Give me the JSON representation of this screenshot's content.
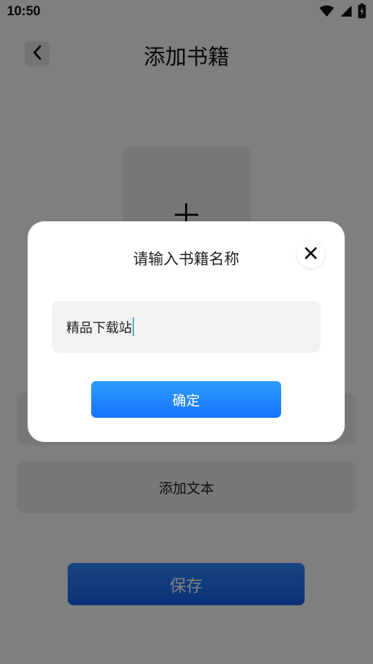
{
  "status_bar": {
    "time": "10:50",
    "icons": [
      "wifi-icon",
      "signal-icon",
      "battery-charging-icon"
    ]
  },
  "header": {
    "title": "添加书籍",
    "back_icon": "chevron-left-icon"
  },
  "cover": {
    "icon": "plus-icon"
  },
  "actions": {
    "add_text_label": "添加文本",
    "save_label": "保存"
  },
  "dialog": {
    "title": "请输入书籍名称",
    "close_icon": "close-icon",
    "input_value": "精品下载站",
    "confirm_label": "确定"
  },
  "colors": {
    "overlay": "rgba(0,0,0,0.5)",
    "accent_blue": "#1773ff",
    "caret": "#46b0b8"
  }
}
